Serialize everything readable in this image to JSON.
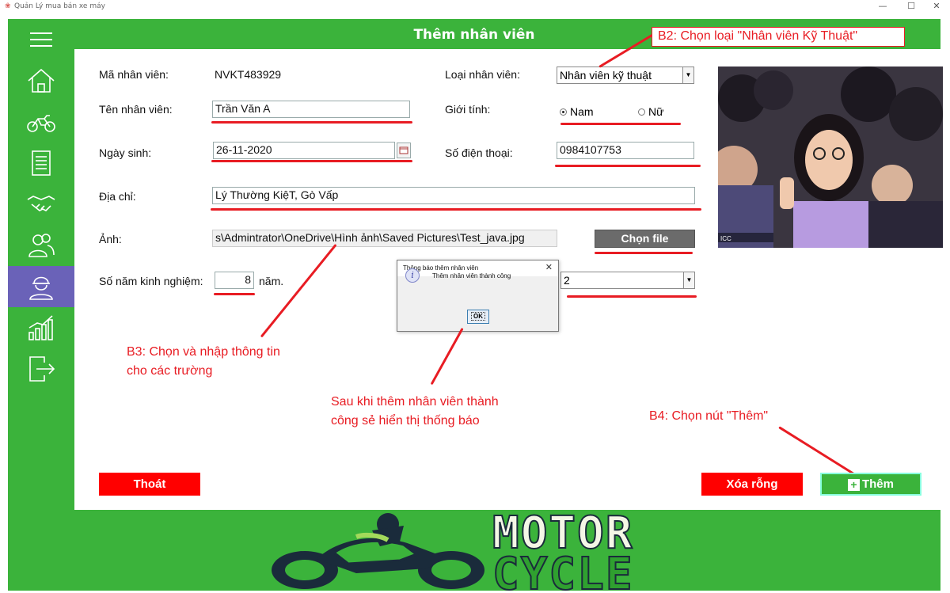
{
  "window": {
    "title": "Quản Lý mua bán xe máy",
    "minimize": "—",
    "maximize": "☐",
    "close": "✕"
  },
  "header": {
    "title": "Thêm nhân viên"
  },
  "sidebar": {
    "items": [
      {
        "name": "menu",
        "icon": "hamburger-menu-icon"
      },
      {
        "name": "home",
        "icon": "home-icon"
      },
      {
        "name": "motorbike",
        "icon": "motorbike-icon"
      },
      {
        "name": "invoice",
        "icon": "document-icon"
      },
      {
        "name": "handshake",
        "icon": "handshake-icon"
      },
      {
        "name": "customers",
        "icon": "users-icon"
      },
      {
        "name": "employees",
        "icon": "worker-icon",
        "active": true
      },
      {
        "name": "statistics",
        "icon": "chart-icon"
      },
      {
        "name": "logout",
        "icon": "logout-icon"
      }
    ]
  },
  "form": {
    "ma_nv_label": "Mã nhân viên:",
    "ma_nv_value": "NVKT483929",
    "loai_nv_label": "Loại nhân viên:",
    "loai_nv_value": "Nhân viên kỹ thuật",
    "ten_nv_label": "Tên nhân viên:",
    "ten_nv_value": "Trần Văn A",
    "gioi_tinh_label": "Giới tính:",
    "gioi_tinh_nam": "Nam",
    "gioi_tinh_nu": "Nữ",
    "ngay_sinh_label": "Ngày sinh:",
    "ngay_sinh_value": "26-11-2020",
    "sdt_label": "Số điện thoại:",
    "sdt_value": "0984107753",
    "dia_chi_label": "Địa chỉ:",
    "dia_chi_value": "Lý Thường KiệT, Gò Vấp",
    "anh_label": "Ảnh:",
    "anh_value": "s\\Admintrator\\OneDrive\\Hình ảnh\\Saved Pictures\\Test_java.jpg",
    "chon_file": "Chọn file",
    "kinh_nghiem_label": "Số năm kinh nghiệm:",
    "kinh_nghiem_value": "8",
    "nam_unit": "năm.",
    "bac_tho_value": "2"
  },
  "photo": {
    "watermark": "ICC"
  },
  "buttons": {
    "thoat": "Thoát",
    "xoa_rong": "Xóa rỗng",
    "them": "Thêm"
  },
  "dialog": {
    "title": "Thông báo thêm nhân viên",
    "close": "✕",
    "message": "Thêm nhân viên thành công",
    "ok": "OK"
  },
  "annotations": {
    "b2": "B2: Chọn loại \"Nhân viên Kỹ Thuật\"",
    "b3_line1": "B3: Chọn và nhập thông tin",
    "b3_line2": "cho các trường",
    "notice_line1": "Sau khi thêm nhân viên thành",
    "notice_line2": "công sẻ hiển thị thống báo",
    "b4": "B4: Chọn nút \"Thêm\""
  },
  "logo": {
    "line1": "MOTOR",
    "line2": "CYCLE"
  },
  "colors": {
    "green": "#3bb33b",
    "active_menu": "#6a62b8",
    "red": "#ff0000",
    "annotation": "#e81c23"
  }
}
